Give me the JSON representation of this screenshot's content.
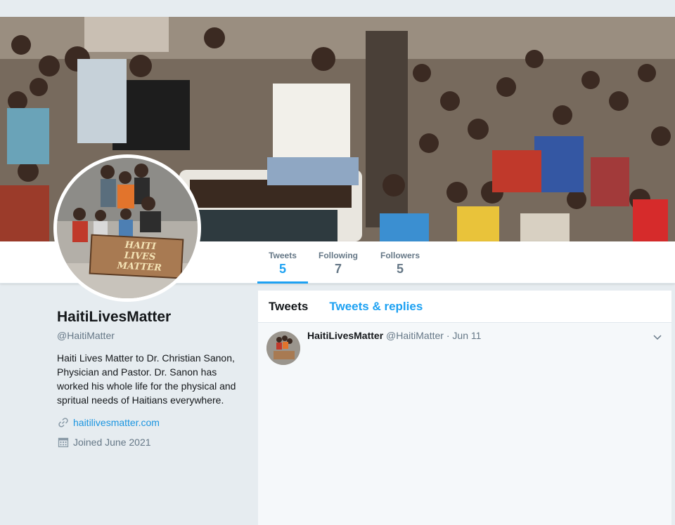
{
  "profile": {
    "name": "HaitiLivesMatter",
    "handle": "@HaitiMatter",
    "bio": "Haiti Lives Matter to Dr. Christian Sanon, Physician and Pastor. Dr. Sanon has worked his whole life for the physical and spritual needs of Haitians everywhere.",
    "website": "haitilivesmatter.com",
    "joined": "Joined June 2021",
    "avatar_sign": [
      "HAITI",
      "LIVES",
      "MATTER"
    ]
  },
  "stats": [
    {
      "label": "Tweets",
      "value": "5",
      "active": true
    },
    {
      "label": "Following",
      "value": "7",
      "active": false
    },
    {
      "label": "Followers",
      "value": "5",
      "active": false
    }
  ],
  "timeline": {
    "tabs": [
      "Tweets",
      "Tweets & replies"
    ],
    "tweets": [
      {
        "name": "HaitiLivesMatter",
        "handle": "@HaitiMatter",
        "separator": "·",
        "date": "Jun 11"
      }
    ]
  },
  "colors": {
    "accent": "#1da1f2",
    "link": "#1b95e0",
    "background": "#e6ecf0",
    "muted": "#657786"
  },
  "icons": {
    "website": "link-icon",
    "joined": "calendar-icon",
    "tweet_menu": "chevron-down-icon"
  }
}
